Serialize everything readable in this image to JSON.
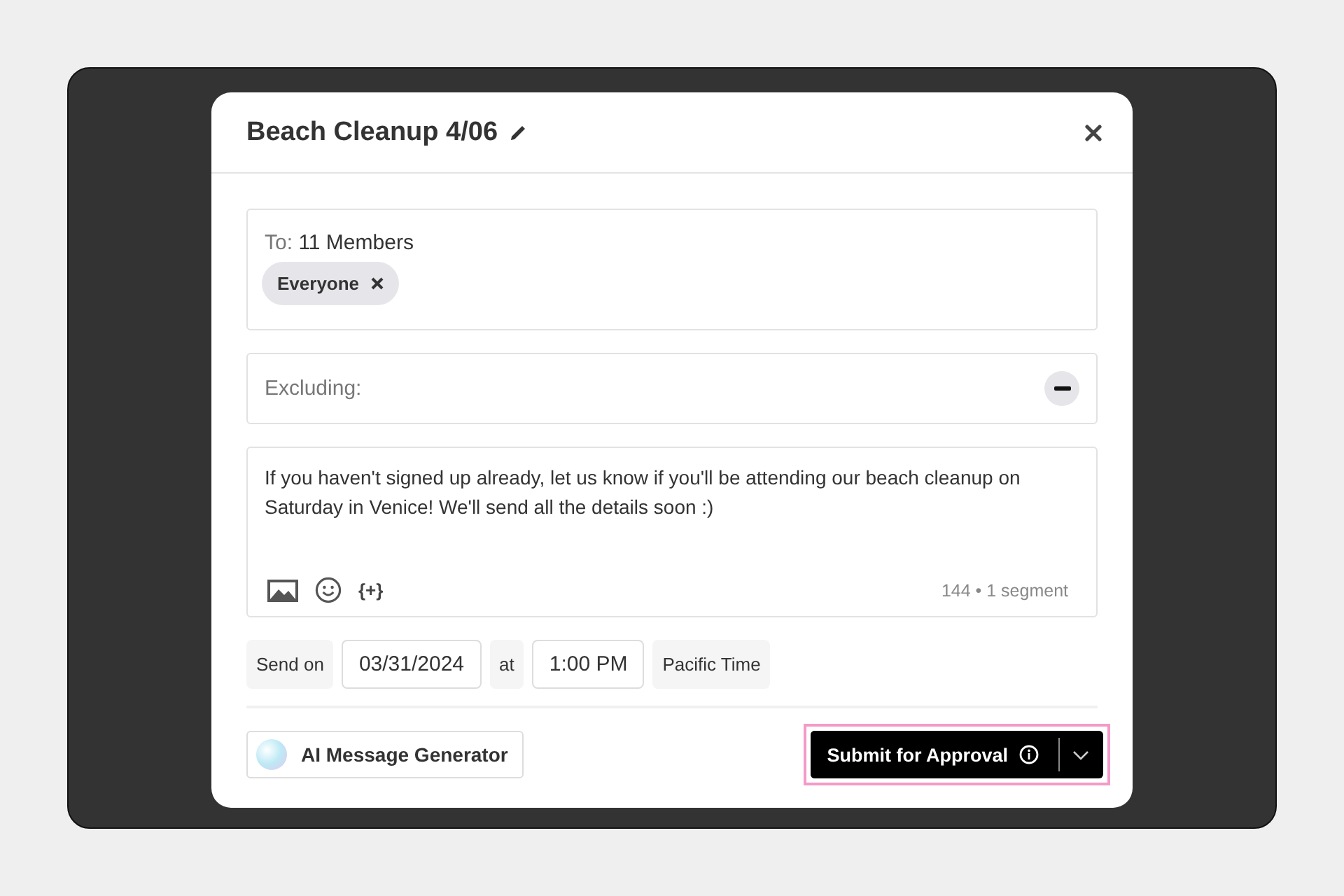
{
  "modal": {
    "title": "Beach Cleanup 4/06",
    "to": {
      "label": "To:",
      "value": "11 Members",
      "chips": [
        {
          "label": "Everyone"
        }
      ]
    },
    "excluding": {
      "label": "Excluding:"
    },
    "message": {
      "text": "If you haven't signed up already, let us know if you'll be attending our beach cleanup on Saturday in Venice! We'll send all the details soon :)",
      "variable_button": "{+}",
      "count": "144",
      "separator": "•",
      "segments": "1 segment"
    },
    "schedule": {
      "send_on_label": "Send on",
      "date": "03/31/2024",
      "at_label": "at",
      "time": "1:00 PM",
      "timezone": "Pacific Time"
    },
    "ai_button": "AI Message Generator",
    "submit_button": "Submit for Approval",
    "submit_highlighted": true
  }
}
